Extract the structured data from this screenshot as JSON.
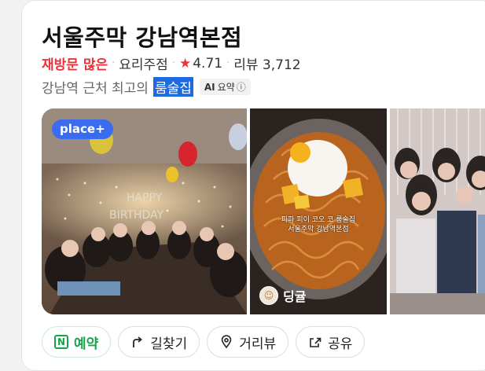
{
  "place": {
    "name": "서울주막 강남역본점",
    "highlight": "재방문 많은",
    "category": "요리주점",
    "rating": "4.71",
    "reviews_label": "리뷰",
    "reviews_count": "3,712",
    "description_prefix": "강남역 근처 최고의",
    "description_keyword": "룸술집",
    "ai_badge_ai": "AI",
    "ai_badge_label": "요약"
  },
  "photos": {
    "badge": "place+",
    "noodle_caption_line1": "파파 피이 코오 코 룸술집",
    "noodle_caption_line2": "서울주막 강남역본점",
    "author_name": "딩귤"
  },
  "actions": {
    "reserve": "예약",
    "directions": "길찾기",
    "street_view": "거리뷰",
    "share": "공유"
  },
  "colors": {
    "highlight": "#e8343c",
    "badge": "#3b6cf0",
    "reserve": "#16a34a",
    "keyword_bg": "#1e6be0"
  },
  "icons": {
    "star": "star-icon",
    "info": "info-icon",
    "reserve": "n-calendar-icon",
    "directions": "turn-arrow-icon",
    "street_view": "location-pin-icon",
    "share": "share-icon"
  }
}
